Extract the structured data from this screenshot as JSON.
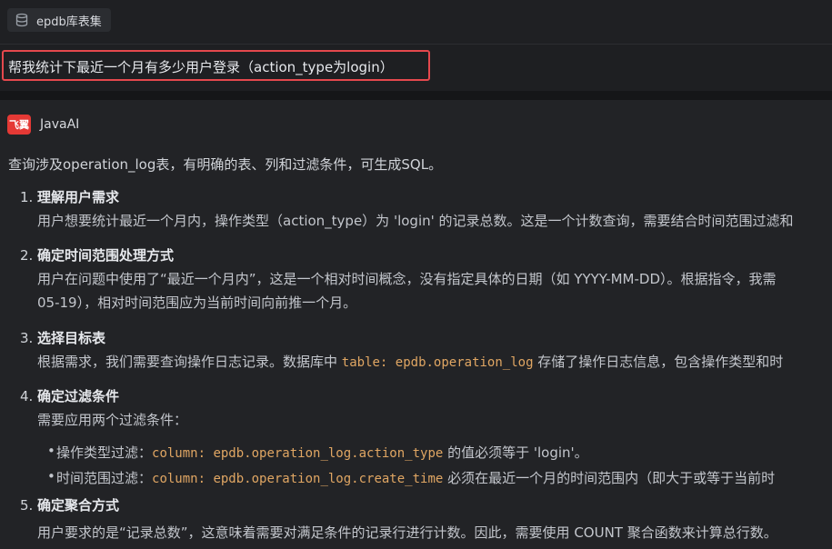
{
  "topbar": {
    "db_label": "epdb库表集",
    "db_icon": "database-icon"
  },
  "user_message": "帮我统计下最近一个月有多少用户登录（action_type为login）",
  "assistant": {
    "name": "JavaAI",
    "logo_text": "飞翼",
    "intro": "查询涉及operation_log表，有明确的表、列和过滤条件，可生成SQL。",
    "steps": [
      {
        "num": "1.",
        "title": "理解用户需求",
        "line1": "用户想要统计最近一个月内，操作类型（action_type）为 'login' 的记录总数。这是一个计数查询，需要结合时间范围过滤和"
      },
      {
        "num": "2.",
        "title": "确定时间范围处理方式",
        "line1": "用户在问题中使用了“最近一个月内”，这是一个相对时间概念，没有指定具体的日期（如 YYYY-MM-DD）。根据指令，我需",
        "line2": "05-19），相对时间范围应为当前时间向前推一个月。"
      },
      {
        "num": "3.",
        "title": "选择目标表",
        "pre": "根据需求，我们需要查询操作日志记录。数据库中 ",
        "code": "table: epdb.operation_log",
        "post": " 存储了操作日志信息，包含操作类型和时"
      },
      {
        "num": "4.",
        "title": "确定过滤条件",
        "line1": "需要应用两个过滤条件：",
        "bullets": [
          {
            "pre": "操作类型过滤：",
            "code": "column: epdb.operation_log.action_type",
            "post": " 的值必须等于 'login'。"
          },
          {
            "pre": "时间范围过滤：",
            "code": "column: epdb.operation_log.create_time",
            "post": " 必须在最近一个月的时间范围内（即大于或等于当前时"
          }
        ]
      },
      {
        "num": "5.",
        "title": "确定聚合方式",
        "line1": "用户要求的是“记录总数”，这意味着需要对满足条件的记录行进行计数。因此，需要使用 COUNT 聚合函数来计算总行数。"
      }
    ]
  }
}
